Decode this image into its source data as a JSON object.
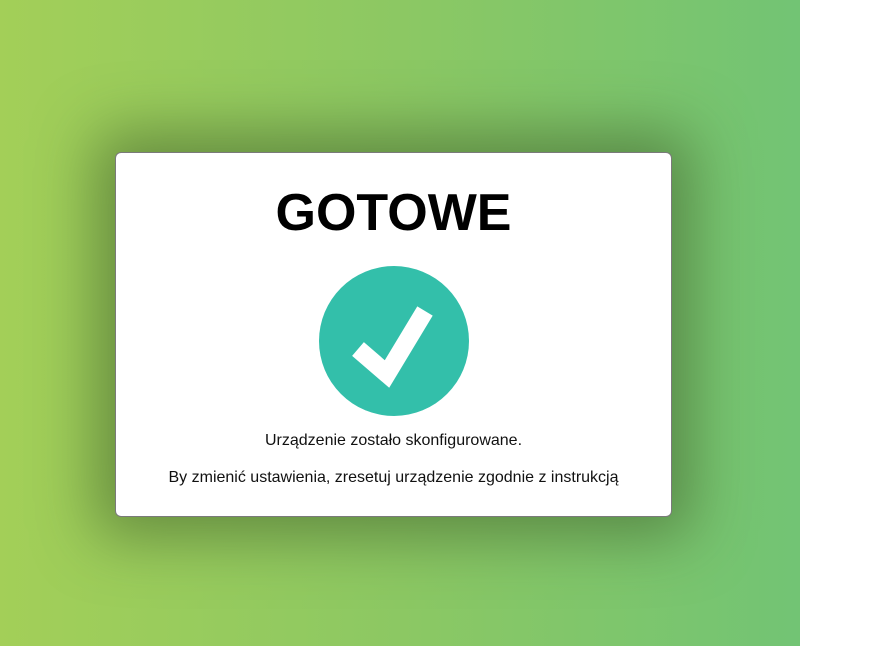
{
  "dialog": {
    "title": "GOTOWE",
    "status_icon": "checkmark-icon",
    "message": "Urządzenie zostało skonfigurowane.",
    "instruction": "By zmienić ustawienia, zresetuj urządzenie zgodnie z instrukcją"
  },
  "colors": {
    "background_gradient": [
      "#a3cf58",
      "#8cc863",
      "#72c474"
    ],
    "check_circle": "#33bfaa",
    "card": "#ffffff"
  }
}
